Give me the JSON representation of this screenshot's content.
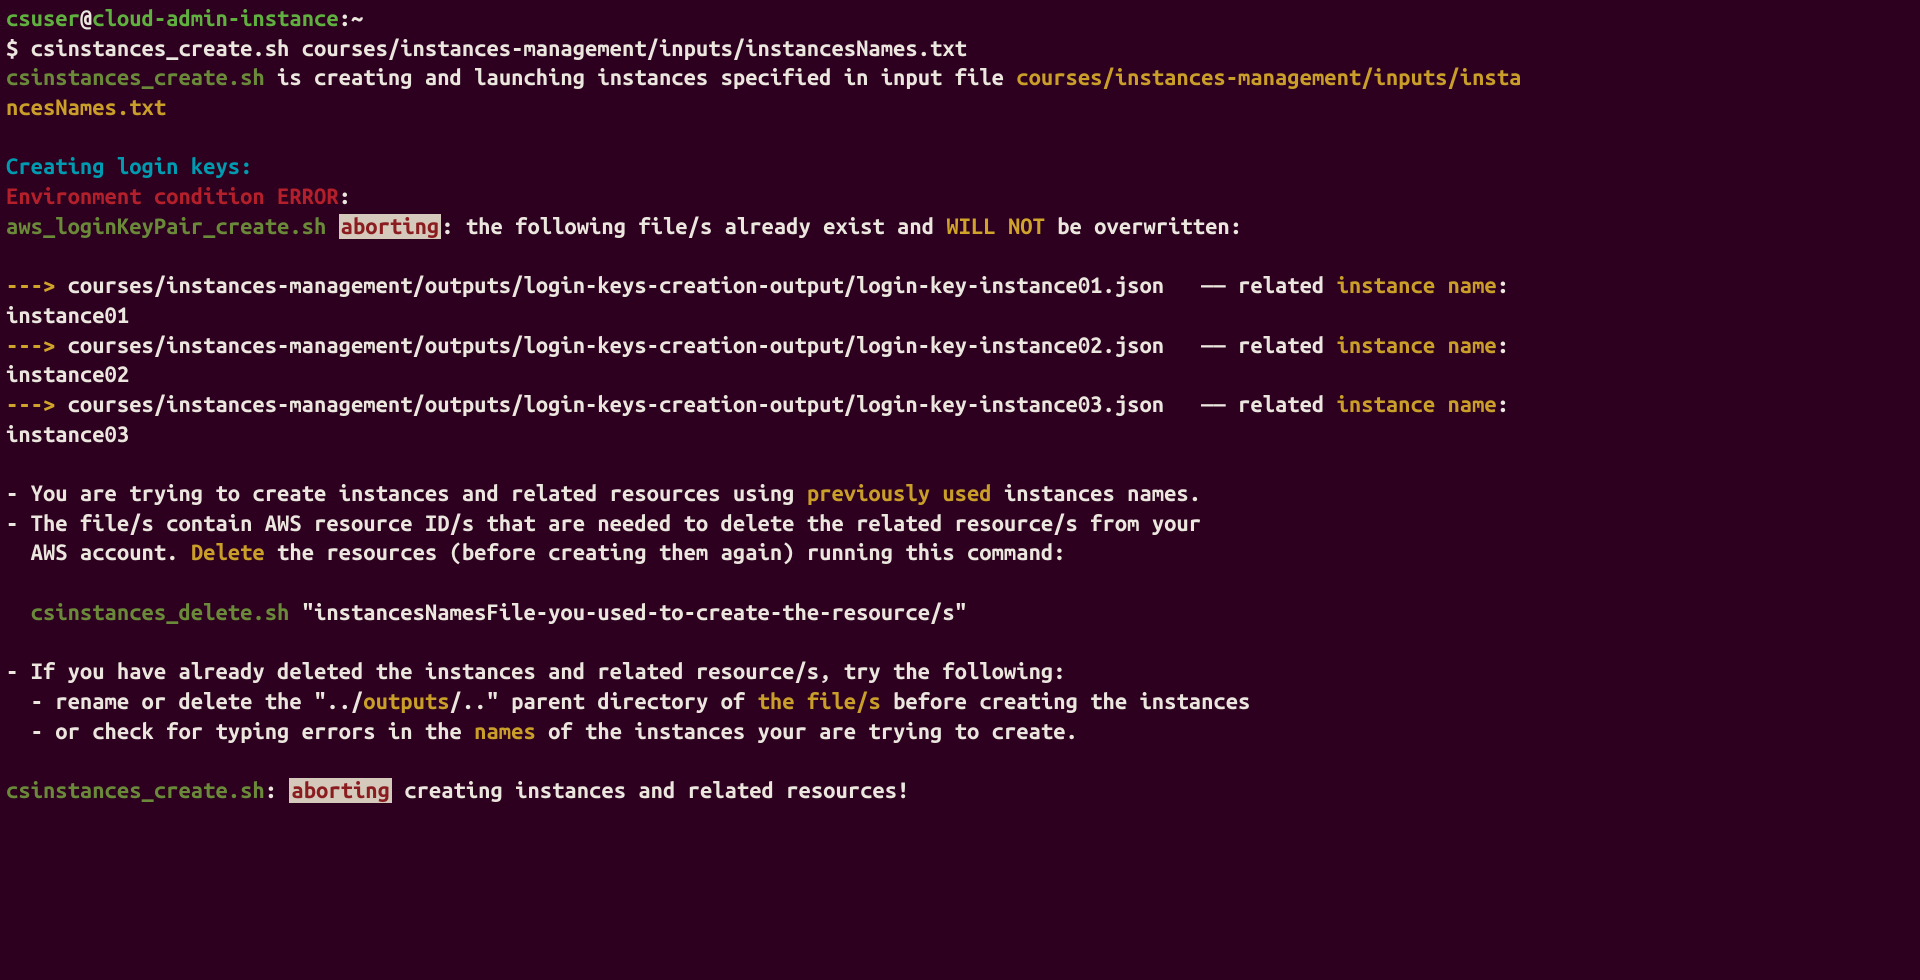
{
  "prompt": {
    "user": "csuser",
    "at": "@",
    "host": "cloud-admin-instance",
    "colon_path_tilde": ":~",
    "dollar": "$ ",
    "command": "csinstances_create.sh courses/instances-management/inputs/instancesNames.txt"
  },
  "line_launch": {
    "script": "csinstances_create.sh",
    "mid": " is creating and launching instances specified in input file ",
    "file": "courses/instances-management/inputs/instancesNames.txt"
  },
  "heading_keys": "Creating login keys:",
  "env_err": "Environment condition ERROR",
  "env_err_colon": ":",
  "abort_line": {
    "script": "aws_loginKeyPair_create.sh",
    "sp": " ",
    "abort": "aborting",
    "mid": ": the following file/s already exist and ",
    "willnot": "WILL NOT",
    "tail": " be overwritten:"
  },
  "gap": "",
  "arrow": "--->",
  "files": [
    {
      "path": " courses/instances-management/outputs/login-keys-creation-output/login-key-instance01.json   —— related ",
      "label": "instance name",
      "colon_sp": ":     ",
      "inst": "instance01"
    },
    {
      "path": " courses/instances-management/outputs/login-keys-creation-output/login-key-instance02.json   —— related ",
      "label": "instance name",
      "colon_sp": ":     ",
      "inst": "instance02"
    },
    {
      "path": " courses/instances-management/outputs/login-keys-creation-output/login-key-instance03.json   —— related ",
      "label": "instance name",
      "colon_sp": ":     ",
      "inst": "instance03"
    }
  ],
  "bullet1": {
    "pre": "- You are trying to create instances and related resources using ",
    "hl": "previously used",
    "post": " instances names."
  },
  "bullet2": {
    "line1": "- The file/s contain AWS resource ID/s that are needed to delete the related resource/s from your",
    "line2_pre": "  AWS account. ",
    "delete": "Delete",
    "line2_post": " the resources (before creating them again) running this command:"
  },
  "cmd_pad": "  ",
  "cmd_script": "csinstances_delete.sh",
  "cmd_arg": " \"instancesNamesFile-you-used-to-create-the-resource/s\"",
  "bullet3": "- If you have already deleted the instances and related resource/s, try the following:",
  "sub1": {
    "pre": "  - rename or delete the \"../",
    "hl1": "outputs",
    "mid": "/..\" parent directory of ",
    "hl2": "the file/s",
    "post": " before creating the instances"
  },
  "sub2": {
    "pre": "  - or check for typing errors in the ",
    "hl": "names",
    "post": " of the instances your are trying to create."
  },
  "final": {
    "script": "csinstances_create.sh",
    "colon_sp": ": ",
    "abort": "aborting",
    "post": " creating instances and related resources!"
  }
}
